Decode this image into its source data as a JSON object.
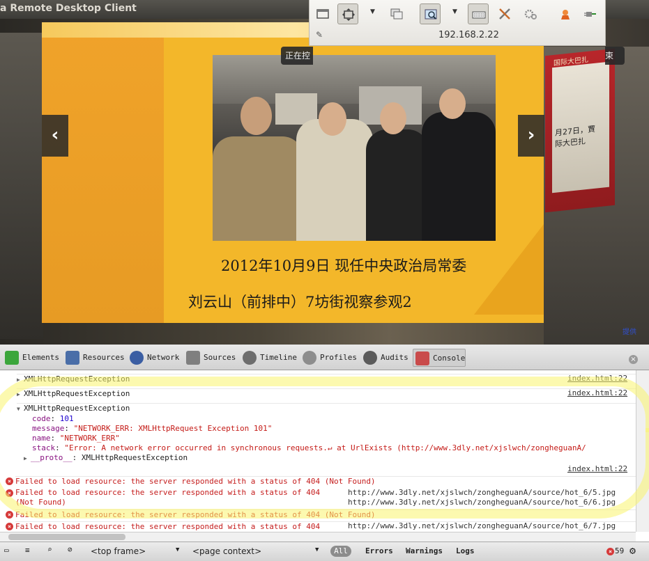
{
  "window": {
    "title": "a Remote Desktop Client"
  },
  "remote_toolbar": {
    "host": "192.168.2.22",
    "overlay_left_text": "正在控",
    "overlay_right_text": "束",
    "buttons": [
      "toggle-fullscreen",
      "scale",
      "scale-dropdown",
      "switch-view",
      "screenshot",
      "screenshot-dropdown",
      "keyboard",
      "tools",
      "preferences",
      "disconnect",
      "minimize"
    ]
  },
  "slide": {
    "caption_line1": "2012年10月9日 现任中央政治局常委",
    "caption_line2": "刘云山（前排中）7坊街视察参观2",
    "prev_label": "‹",
    "next_label": "›",
    "poster_title": "国际大巴扎",
    "poster_text_1": "月27日，賈",
    "poster_text_2": "际大巴扎",
    "side_link": "提供"
  },
  "devtools": {
    "tabs": [
      {
        "label": "Elements",
        "color": "#3ca63c"
      },
      {
        "label": "Resources",
        "color": "#4a6ea8"
      },
      {
        "label": "Network",
        "color": "#3b5ea3"
      },
      {
        "label": "Sources",
        "color": "#7f7f7f"
      },
      {
        "label": "Timeline",
        "color": "#6d6d6d"
      },
      {
        "label": "Profiles",
        "color": "#8d8d8d"
      },
      {
        "label": "Audits",
        "color": "#5b5b5b"
      },
      {
        "label": "Console",
        "color": "#c94b4b"
      }
    ],
    "selected_tab": "Console",
    "console": {
      "collapsed_1": "XMLHttpRequestException",
      "collapsed_2": "XMLHttpRequestException",
      "expanded": "XMLHttpRequestException",
      "code_key": "code",
      "code_value": "101",
      "message_key": "message",
      "message_value": "\"NETWORK_ERR: XMLHttpRequest Exception 101\"",
      "name_key": "name",
      "name_value": "\"NETWORK_ERR\"",
      "stack_key": "stack",
      "stack_value": "\"Error: A network error occurred in synchronous requests.↵    at UrlExists (http://www.3dly.net/xjslwch/zongheguanA/",
      "proto_key": "__proto__",
      "proto_value": "XMLHttpRequestException",
      "source_link": "index.html:22",
      "errors": [
        {
          "text": "Failed to load resource: the server responded with a status of 404 (Not Found)",
          "url": "http://www.3dly.net/xjslwch/zongheguanA/source/hot_6/5.jpg"
        },
        {
          "text": "Failed to load resource: the server responded with a status of 404",
          "text2": "(Not Found)",
          "url": "http://www.3dly.net/xjslwch/zongheguanA/source/hot_6/6.jpg"
        },
        {
          "text": "Failed to load resource: the server responded with a status of 404 (Not Found)",
          "url": ""
        },
        {
          "text": "Failed to load resource: the server responded with a status of 404",
          "url": "http://www.3dly.net/xjslwch/zongheguanA/source/hot_6/7.jpg"
        }
      ]
    },
    "statusbar": {
      "frame": "<top frame>",
      "context": "<page context>",
      "filter_all": "All",
      "filter_errors": "Errors",
      "filter_warnings": "Warnings",
      "filter_logs": "Logs",
      "error_count": "59"
    }
  }
}
